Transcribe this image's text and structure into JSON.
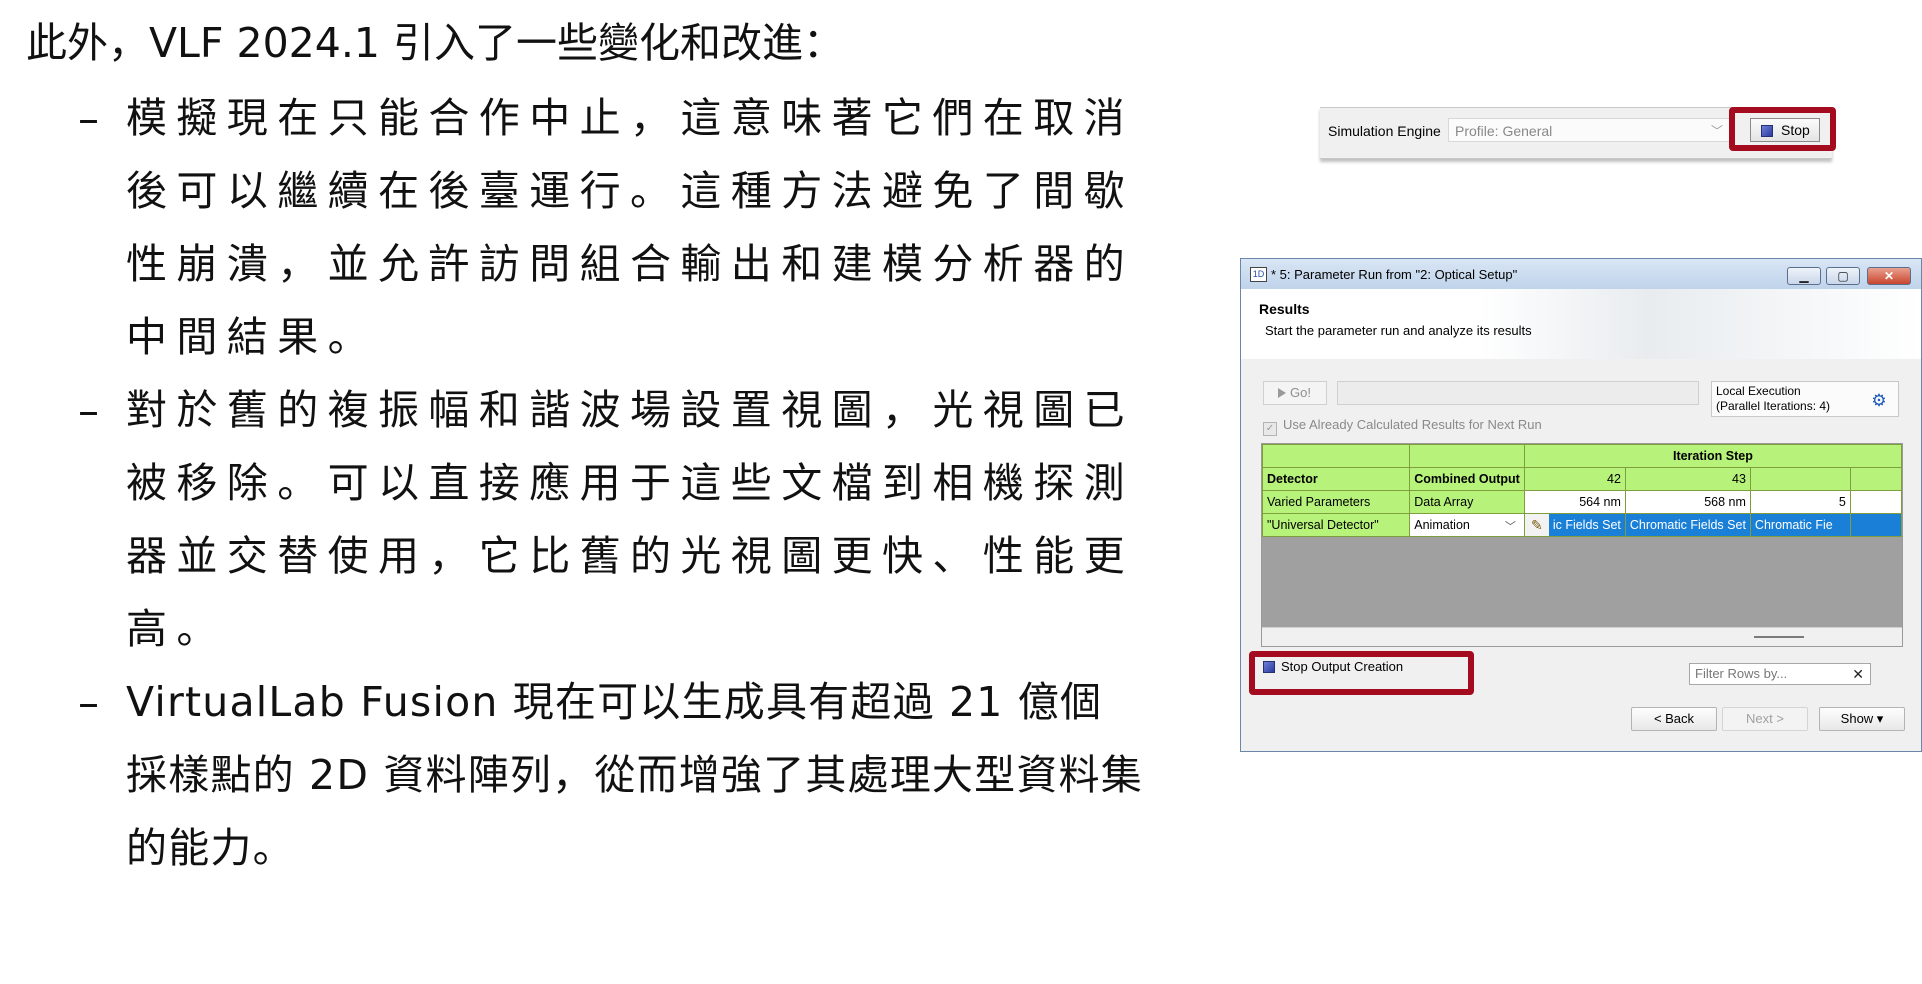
{
  "slide": {
    "intro": "此外，VLF 2024.1 引入了一些變化和改進：",
    "bullet_marker": "–",
    "bullets": [
      "模擬現在只能合作中止，這意味著它們在取消後可以繼續在後臺運行。這種方法避免了間歇性崩潰，並允許訪問組合輸出和建模分析器的中間結果。",
      "對於舊的複振幅和諧波場設置視圖，光視圖已被移除。可以直接應用于這些文檔到相機探測器並交替使用，它比舊的光視圖更快、性能更高。",
      "VirtualLab Fusion 現在可以生成具有超過 21 億個採樣點的 2D 資料陣列，從而增強了其處理大型資料集的能力。"
    ]
  },
  "toolbar": {
    "engine_label": "Simulation Engine",
    "profile_value": "Profile: General",
    "stop_label": "Stop"
  },
  "dialog": {
    "title": "* 5: Parameter Run from \"2: Optical Setup\"",
    "app_icon_text": "1D",
    "header_title": "Results",
    "header_subtitle": "Start the parameter run and analyze its results",
    "go_label": "Go!",
    "exec_line1": "Local Execution",
    "exec_line2": "(Parallel Iterations: 4)",
    "reuse_label": "Use Already Calculated Results for Next Run",
    "grid": {
      "iteration_step": "Iteration Step",
      "detector": "Detector",
      "combined_output": "Combined Output",
      "step_42": "42",
      "step_43": "43",
      "varied_parameters": "Varied Parameters",
      "data_array": "Data Array",
      "value_564": "564 nm",
      "value_568": "568 nm",
      "value_partial": "5",
      "universal_detector": "\"Universal Detector\"",
      "animation": "Animation",
      "chromatic_partial": "ic Fields Set",
      "chromatic_full": "Chromatic Fields Set",
      "chromatic_cut": "Chromatic Fie"
    },
    "stop_output": "Stop Output Creation",
    "filter_placeholder": "Filter Rows by...",
    "back": "< Back",
    "next": "Next >",
    "show": "Show ▾"
  },
  "colors": {
    "highlight": "#a50b1f",
    "grid_green": "#b7f27a",
    "grid_blue": "#1a7fd6"
  }
}
